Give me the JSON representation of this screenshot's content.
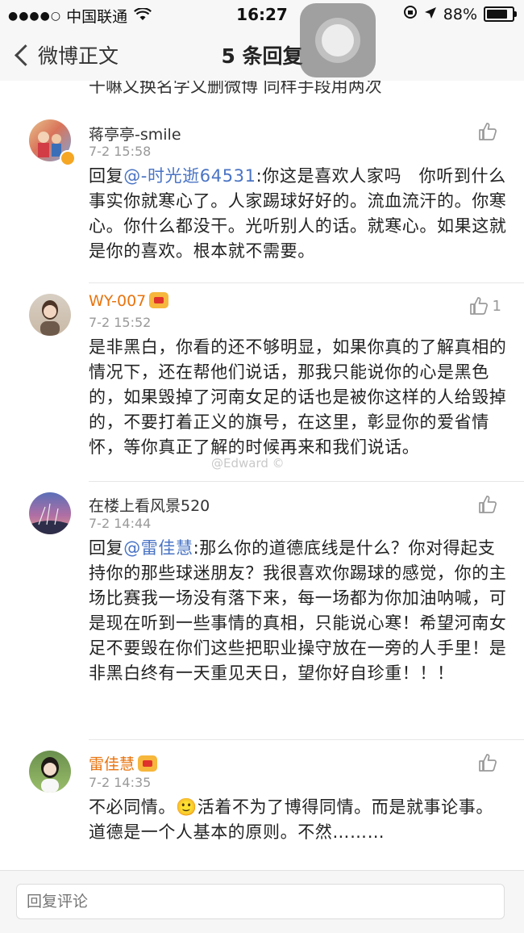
{
  "status_bar": {
    "signal": "●●●●○",
    "carrier": "中国联通",
    "wifi_icon": "wifi-icon",
    "time": "16:27",
    "battery": "88%",
    "battery_level": 0.88
  },
  "nav": {
    "back_label": "微博正文",
    "title": "5 条回复"
  },
  "partial_text": "干嘛又换名字又删微博 同样手段用两次",
  "comments": [
    {
      "user": "蒋亭亭-smile",
      "vip": false,
      "date": "7-2 15:58",
      "likes": "",
      "prefix": "回复",
      "mention": "@-时光逝64531",
      "text": ":你这是喜欢人家吗　你听到什么事实你就寒心了。人家踢球好好的。流血流汗的。你寒心。你什么都没干。光听别人的话。就寒心。如果这就是你的喜欢。根本就不需要。"
    },
    {
      "user": "WY-007",
      "vip": true,
      "date": "7-2 15:52",
      "likes": "1",
      "prefix": "",
      "mention": "",
      "text": "是非黑白，你看的还不够明显，如果你真的了解真相的情况下，还在帮他们说话，那我只能说你的心是黑色的，如果毁掉了河南女足的话也是被你这样的人给毁掉的，不要打着正义的旗号，在这里，彰显你的爱省情怀，等你真正了解的时候再来和我们说话。"
    },
    {
      "user": "在楼上看风景520",
      "vip": false,
      "date": "7-2 14:44",
      "likes": "",
      "prefix": "回复",
      "mention": "@雷佳慧",
      "text": ":那么你的道德底线是什么？你对得起支持你的那些球迷朋友？我很喜欢你踢球的感觉，你的主场比赛我一场没有落下来，每一场都为你加油呐喊，可是现在听到一些事情的真相，只能说心寒！希望河南女足不要毁在你们这些把职业操守放在一旁的人手里！是非黑白终有一天重见天日，望你好自珍重！！！"
    },
    {
      "user": "雷佳慧",
      "vip": true,
      "date": "7-2 14:35",
      "likes": "",
      "prefix": "",
      "mention": "",
      "text": "不必同情。🙂活着不为了博得同情。而是就事论事。道德是一个人基本的原则。不然………"
    }
  ],
  "watermark": "@Edward ©",
  "reply": {
    "placeholder": "回复评论"
  },
  "colors": {
    "mention": "#4a74c4",
    "vip_name": "#e8740f",
    "meta": "#999999"
  }
}
